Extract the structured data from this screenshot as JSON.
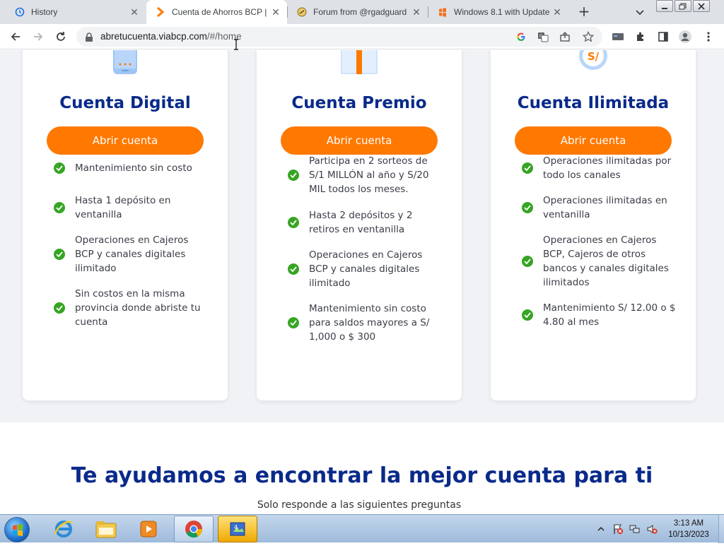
{
  "browser": {
    "tabs": [
      {
        "title": "History",
        "favicon": "history-icon"
      },
      {
        "title": "Cuenta de Ahorros BCP |",
        "favicon": "bcp-chevron-icon"
      },
      {
        "title": "Forum from @rgadguard",
        "favicon": "forum-icon"
      },
      {
        "title": "Windows 8.1 with Update",
        "favicon": "windows-orange-icon"
      }
    ],
    "active_tab_index": 1,
    "new_tab": "+",
    "url": {
      "host": "abretucuenta.viabcp.com",
      "path": "/#/home"
    }
  },
  "cards": [
    {
      "title": "Cuenta Digital",
      "icon": "phone-icon",
      "button": "Abrir cuenta",
      "features": [
        "Mantenimiento sin costo",
        "Hasta 1 depósito en ventanilla",
        "Operaciones en Cajeros BCP y canales digitales ilimitado",
        "Sin costos en la misma provincia donde abriste tu cuenta"
      ]
    },
    {
      "title": "Cuenta Premio",
      "icon": "gift-icon",
      "button": "Abrir cuenta",
      "features": [
        "Participa en 2 sorteos de S/1 MILLÓN al año y S/20 MIL todos los meses.",
        "Hasta 2 depósitos y 2 retiros en ventanilla",
        "Operaciones en Cajeros BCP y canales digitales ilimitado",
        "Mantenimiento sin costo para saldos mayores a S/ 1,000 o $ 300"
      ]
    },
    {
      "title": "Cuenta Ilimitada",
      "icon": "soles-coin-icon",
      "icon_text": "S/",
      "button": "Abrir cuenta",
      "features": [
        "Operaciones ilimitadas por todo los canales",
        "Operaciones ilimitadas en ventanilla",
        "Operaciones en Cajeros BCP, Cajeros de otros bancos y canales digitales ilimitados",
        "Mantenimiento S/ 12.00 o $ 4.80 al mes"
      ]
    }
  ],
  "help_section": {
    "title": "Te ayudamos a encontrar la mejor cuenta para ti",
    "subtitle": "Solo responde a las siguientes preguntas"
  },
  "taskbar": {
    "time": "3:13 AM",
    "date": "10/13/2023",
    "apps": [
      "internet-explorer-icon",
      "file-explorer-icon",
      "media-player-icon",
      "chrome-icon",
      "app-icon"
    ]
  },
  "colors": {
    "brand_blue": "#0a2a8a",
    "brand_orange": "#ff7800",
    "check_green": "#37a524"
  }
}
